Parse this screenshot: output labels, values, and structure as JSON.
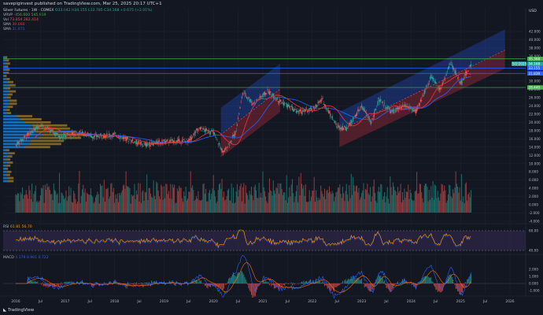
{
  "header": {
    "publish_line": "savepiginvest published on TradingView.com, Mar 25, 2025 20:17 UTC+1"
  },
  "legend": {
    "symbol": "Silver Futures · 1W · COMEX",
    "ohlc": "O33.042 H34.155 L33.785 C34.168 +0.675 (+2.01%)",
    "vrvp_label": "VRVP",
    "vrvp_values": "-456.660 545.919",
    "vol_label": "Vol",
    "vol_values": "73.854 282.414",
    "sma1_label": "SMA",
    "sma1_value": "30.660",
    "sma2_label": "SMA",
    "sma2_value": "31.071"
  },
  "rsi_legend": {
    "label": "RSI",
    "values": "61.81 56.70"
  },
  "macd_legend": {
    "label": "MACD",
    "values": "0.179 0.901 0.722"
  },
  "price_axis": {
    "currency": "USD",
    "ticks": [
      "42.000",
      "40.000",
      "38.000",
      "36.000",
      "34.000",
      "32.000",
      "30.000",
      "28.000",
      "26.000",
      "24.000",
      "22.000",
      "20.000",
      "18.000",
      "16.000",
      "14.000",
      "12.000",
      "10.000",
      "8.000",
      "6.000",
      "4.000",
      "2.000",
      "0.000",
      "-2.000",
      "-4.000"
    ],
    "badges": [
      {
        "text": "35.368",
        "value": 35.368,
        "color": "#4caf50"
      },
      {
        "text": "34.168",
        "value": 34.168,
        "color": "#26a69a"
      },
      {
        "text": "33.155",
        "value": 33.155,
        "color": "#2962ff"
      },
      {
        "text": "31.839",
        "value": 31.839,
        "color": "#2962ff"
      },
      {
        "text": "28.440",
        "value": 28.44,
        "color": "#4caf50"
      }
    ],
    "current_tag": "SI1!2025"
  },
  "rsi_axis": {
    "ticks": [
      "60.00",
      "40.00"
    ]
  },
  "macd_axis": {
    "ticks": [
      "2.000",
      "1.000",
      "0.000",
      "-1.000"
    ]
  },
  "time_axis": {
    "labels": [
      "2016",
      "Jul",
      "2017",
      "Jul",
      "2018",
      "Jul",
      "2019",
      "Jul",
      "2020",
      "Jul",
      "2021",
      "Jul",
      "2022",
      "Jul",
      "2023",
      "Jul",
      "2024",
      "Jul",
      "2025",
      "Jul",
      "2026"
    ]
  },
  "colors": {
    "background": "#131722",
    "up": "#26a69a",
    "down": "#ef5350",
    "sma_blue": "#2962ff",
    "sma_red": "#f23645",
    "channel_blue": "#2962ff",
    "channel_red": "#f23645",
    "rsi_line": "#ff9800",
    "macd_line": "#2962ff",
    "signal_line": "#ff6d00"
  },
  "footer": {
    "brand": "TradingView"
  }
}
